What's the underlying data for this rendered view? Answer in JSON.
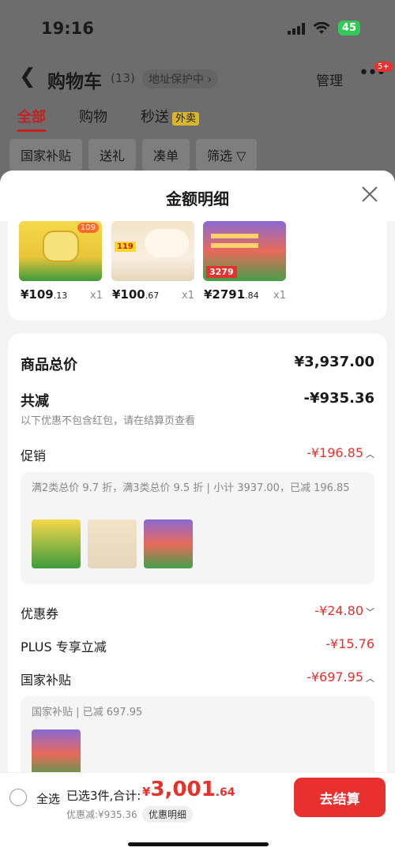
{
  "status": {
    "time": "19:16",
    "battery": "45"
  },
  "header": {
    "title": "购物车",
    "count": "(13)",
    "address_protect": "地址保护中 ›",
    "manage": "管理",
    "msg_badge": "5+"
  },
  "tabs": [
    {
      "label": "全部"
    },
    {
      "label": "购物"
    },
    {
      "label": "秒送"
    }
  ],
  "waimai_tag": "外卖",
  "filters": [
    "国家补贴",
    "送礼",
    "凑单",
    "筛选 ▽"
  ],
  "sheet": {
    "title": "金额明细"
  },
  "products": [
    {
      "price_int": "¥109",
      "price_dec": ".13",
      "qty": "x1",
      "tag": "109"
    },
    {
      "price_int": "¥100",
      "price_dec": ".67",
      "qty": "x1",
      "tag": "119"
    },
    {
      "price_int": "¥2791",
      "price_dec": ".84",
      "qty": "x1",
      "tag": "3279"
    }
  ],
  "summary": {
    "goods_total_label": "商品总价",
    "goods_total_value": "¥3,937.00",
    "total_discount_label": "共减",
    "total_discount_value": "-¥935.36",
    "note": "以下优惠不包含红包，请在结算页查看",
    "promo_label": "促销",
    "promo_value": "-¥196.85",
    "promo_detail": "满2类总价 9.7 折，满3类总价 9.5 折 | 小计 3937.00，已减 196.85",
    "coupon_label": "优惠券",
    "coupon_value": "-¥24.80",
    "plus_label": "PLUS 专享立减",
    "plus_value": "-¥15.76",
    "subsidy_label": "国家补贴",
    "subsidy_value": "-¥697.95",
    "subsidy_detail": "国家补贴 | 已减 697.95"
  },
  "bottom": {
    "select_all": "全选",
    "selected_sum": "已选3件,合计:",
    "currency": "¥",
    "total_int": "3,001",
    "total_dec": ".64",
    "discount_line": "优惠减:¥935.36",
    "detail_pill": "优惠明细",
    "checkout": "去结算"
  },
  "colors": {
    "accent_red": "#e5322d",
    "checkout_red": "#e8312e",
    "plus_green": "#34c759"
  }
}
